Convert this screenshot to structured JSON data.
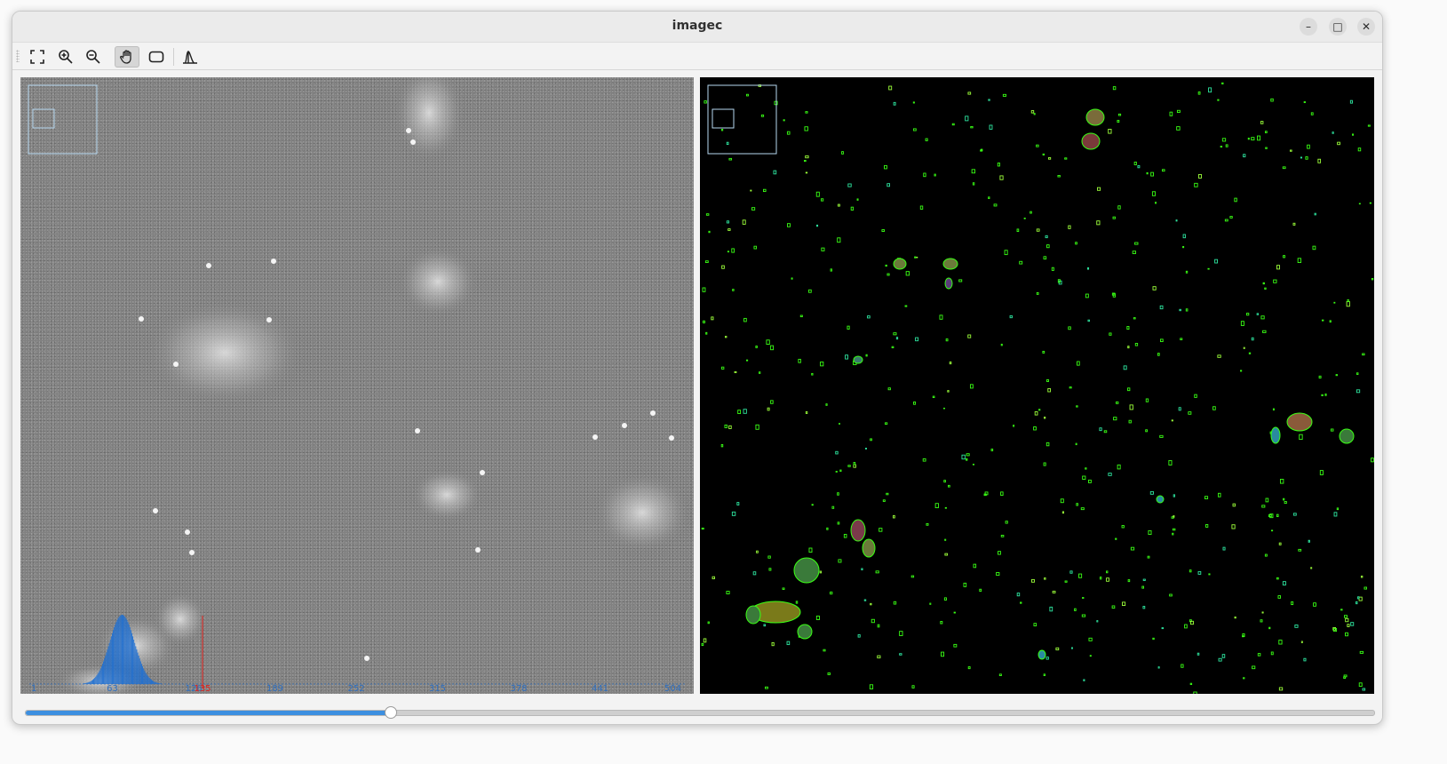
{
  "window": {
    "title": "imagec",
    "controls": {
      "minimize": "–",
      "maximize": "□",
      "close": "✕"
    }
  },
  "toolbar": {
    "tools": [
      {
        "name": "fit-view-icon",
        "active": false
      },
      {
        "name": "zoom-in-icon",
        "active": false
      },
      {
        "name": "zoom-out-icon",
        "active": false
      },
      {
        "name": "pan-hand-icon",
        "active": true
      },
      {
        "name": "rectangle-select-icon",
        "active": false
      },
      {
        "name": "histogram-icon",
        "active": false
      }
    ]
  },
  "histogram": {
    "tick_labels": [
      "1",
      "63",
      "126",
      "189",
      "252",
      "315",
      "378",
      "441",
      "504"
    ],
    "threshold_label": "135",
    "colors": {
      "bars": "#1f6fd1",
      "threshold": "#e0201b",
      "axis": "#2f6fbf"
    }
  },
  "slider": {
    "value_fraction": 0.27
  },
  "colors": {
    "accent": "#3d8fe0",
    "overlay_green": "#39ff14",
    "overlay_box": "#b6d8f0"
  }
}
